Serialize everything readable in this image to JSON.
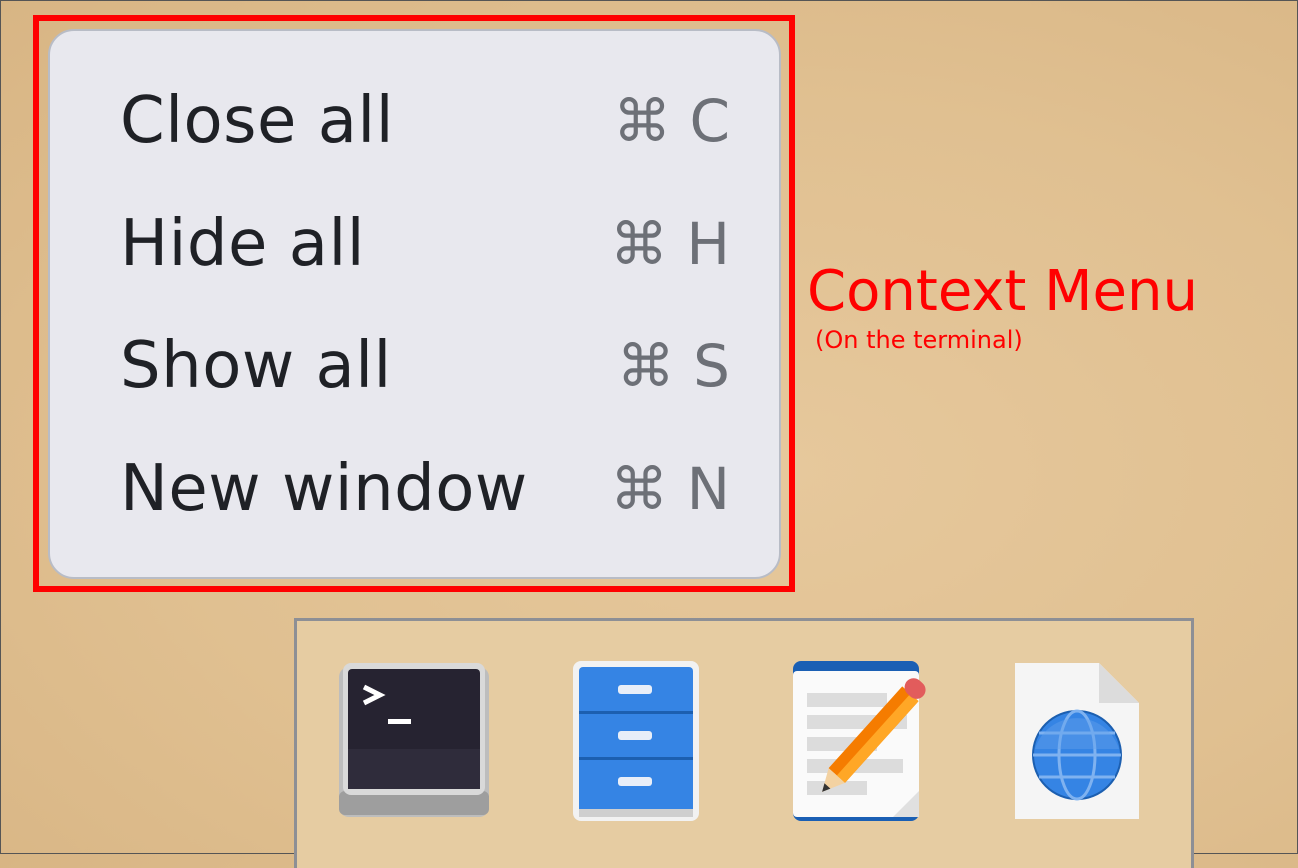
{
  "annotation": {
    "title": "Context Menu",
    "subtitle": "(On the terminal)",
    "color": "#ff0000"
  },
  "context_menu": {
    "items": [
      {
        "label": "Close all",
        "shortcut": "⌘ C"
      },
      {
        "label": "Hide all",
        "shortcut": "⌘ H"
      },
      {
        "label": "Show all",
        "shortcut": "⌘ S"
      },
      {
        "label": "New window",
        "shortcut": "⌘ N"
      }
    ]
  },
  "dock": {
    "apps": [
      {
        "icon": "terminal-icon"
      },
      {
        "icon": "file-manager-icon"
      },
      {
        "icon": "text-editor-icon"
      },
      {
        "icon": "web-browser-icon"
      }
    ]
  }
}
